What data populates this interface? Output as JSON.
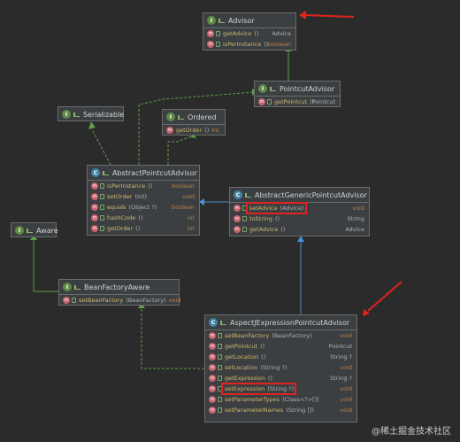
{
  "nodes": {
    "advisor": {
      "kind": "I",
      "title": "Advisor",
      "members": [
        {
          "name": "getAdvice",
          "params": "()",
          "ret": "Advice",
          "prim": false
        },
        {
          "name": "isPerInstance",
          "params": "()",
          "ret": "boolean",
          "prim": true
        }
      ]
    },
    "pointcut_advisor": {
      "kind": "I",
      "title": "PointcutAdvisor",
      "members": [
        {
          "name": "getPointcut",
          "params": "()",
          "ret": "Pointcut",
          "prim": false
        }
      ]
    },
    "serializable": {
      "kind": "I",
      "title": "Serializable"
    },
    "ordered": {
      "kind": "I",
      "title": "Ordered",
      "members": [
        {
          "name": "getOrder",
          "params": "()",
          "ret": "int",
          "prim": true
        }
      ]
    },
    "abstract_pointcut_advisor": {
      "kind": "C",
      "title": "AbstractPointcutAdvisor",
      "members": [
        {
          "name": "isPerInstance",
          "params": "()",
          "ret": "boolean",
          "prim": true
        },
        {
          "name": "setOrder",
          "params": "(int)",
          "ret": "void",
          "prim": true
        },
        {
          "name": "equals",
          "params": "(Object ?)",
          "ret": "boolean",
          "prim": true
        },
        {
          "name": "hashCode",
          "params": "()",
          "ret": "int",
          "prim": true
        },
        {
          "name": "getOrder",
          "params": "()",
          "ret": "int",
          "prim": true
        }
      ]
    },
    "abstract_generic_pointcut_advisor": {
      "kind": "C",
      "title": "AbstractGenericPointcutAdvisor",
      "members": [
        {
          "name": "setAdvice",
          "params": "(Advice)",
          "ret": "void",
          "prim": true
        },
        {
          "name": "toString",
          "params": "()",
          "ret": "String",
          "prim": false
        },
        {
          "name": "getAdvice",
          "params": "()",
          "ret": "Advice",
          "prim": false
        }
      ]
    },
    "aware": {
      "kind": "I",
      "title": "Aware"
    },
    "bean_factory_aware": {
      "kind": "I",
      "title": "BeanFactoryAware",
      "members": [
        {
          "name": "setBeanFactory",
          "params": "(BeanFactory)",
          "ret": "void",
          "prim": true
        }
      ]
    },
    "aspectj_expression_pointcut_advisor": {
      "kind": "C",
      "title": "AspectJExpressionPointcutAdvisor",
      "members": [
        {
          "name": "setBeanFactory",
          "params": "(BeanFactory)",
          "ret": "void",
          "prim": true
        },
        {
          "name": "getPointcut",
          "params": "()",
          "ret": "Pointcut",
          "prim": false
        },
        {
          "name": "getLocation",
          "params": "()",
          "ret": "String ?",
          "prim": false
        },
        {
          "name": "setLocation",
          "params": "(String ?)",
          "ret": "void",
          "prim": true
        },
        {
          "name": "getExpression",
          "params": "()",
          "ret": "String ?",
          "prim": false
        },
        {
          "name": "setExpression",
          "params": "(String ?)",
          "ret": "void",
          "prim": true
        },
        {
          "name": "setParameterTypes",
          "params": "(Class<?>[])",
          "ret": "void",
          "prim": true
        },
        {
          "name": "setParameterNames",
          "params": "(String [])",
          "ret": "void",
          "prim": true
        }
      ]
    }
  },
  "watermark": "@稀土掘金技术社区",
  "colors": {
    "interface_extends": "#5f9e4a",
    "class_extends": "#4a8fd6",
    "highlight": "#e0231f"
  }
}
